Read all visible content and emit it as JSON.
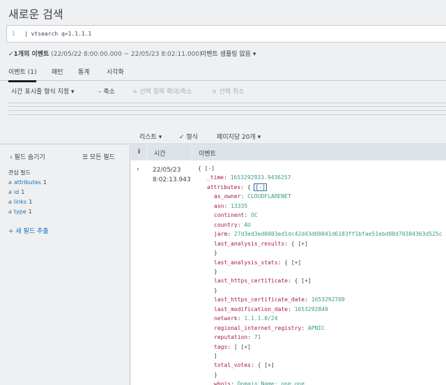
{
  "page": {
    "title": "새로운 검색"
  },
  "search": {
    "line_number": "1",
    "query": "| vtsearch q=1.1.1.1"
  },
  "summary": {
    "check": "✓",
    "count": "1개의 이벤트",
    "range": "(22/05/22 8:00:00.000 ~ 22/05/23 8:02:11.000)",
    "sampling": "이벤트 샘플링 없음 ▾"
  },
  "tabs": [
    "이벤트 (1)",
    "패턴",
    "통계",
    "시각화"
  ],
  "toolbar": {
    "time_format": "시간 표시줄 형식 지정 ▾",
    "zoom_out": "– 축소",
    "zoom_selection": "+ 선택 항목 확대/축소",
    "deselect": "× 선택 취소"
  },
  "pager": {
    "list": "리스트 ▾",
    "format": "✓ 형식",
    "per_page": "페이지당 20개 ▾"
  },
  "sidebar": {
    "hide_fields": "‹ 필드 숨기기",
    "all_fields": "☰ 모든 필드",
    "interesting_title": "관심 필드",
    "fields": [
      {
        "type": "a",
        "name": "attributes",
        "count": "1"
      },
      {
        "type": "a",
        "name": "id",
        "count": "1"
      },
      {
        "type": "a",
        "name": "links",
        "count": "1"
      },
      {
        "type": "a",
        "name": "type",
        "count": "1"
      }
    ],
    "extract": "+ 새 필드 추출"
  },
  "grid": {
    "info_icon": "i",
    "time_header": "시간",
    "event_header": "이벤트"
  },
  "event": {
    "expander": "›",
    "date": "22/05/23",
    "time": "8:02:13.943",
    "lines": [
      {
        "indent": 0,
        "key": "",
        "value": "",
        "tail": "{ [-]"
      },
      {
        "indent": 1,
        "key": "_time",
        "value": "1653292933.9436257",
        "tail": ""
      },
      {
        "indent": 1,
        "key": "attributes",
        "value": "",
        "tail": "{",
        "toggle": "[-]",
        "selected": true
      },
      {
        "indent": 2,
        "key": "as_owner",
        "value": "CLOUDFLARENET",
        "tail": ""
      },
      {
        "indent": 2,
        "key": "asn",
        "value": "13335",
        "tail": ""
      },
      {
        "indent": 2,
        "key": "continent",
        "value": "OC",
        "tail": ""
      },
      {
        "indent": 2,
        "key": "country",
        "value": "AU",
        "tail": ""
      },
      {
        "indent": 2,
        "key": "jarm",
        "value": "27d3ed3ed0003ed1dc42d43d00041d6183ff1bfae51ebd88d70384363d525c",
        "tail": ""
      },
      {
        "indent": 2,
        "key": "last_analysis_results",
        "value": "",
        "tail": "{",
        "toggle": "[+]"
      },
      {
        "indent": 2,
        "key": "",
        "value": "",
        "tail": "}"
      },
      {
        "indent": 2,
        "key": "last_analysis_stats",
        "value": "",
        "tail": "{",
        "toggle": "[+]"
      },
      {
        "indent": 2,
        "key": "",
        "value": "",
        "tail": "}"
      },
      {
        "indent": 2,
        "key": "last_https_certificate",
        "value": "",
        "tail": "{",
        "toggle": "[+]"
      },
      {
        "indent": 2,
        "key": "",
        "value": "",
        "tail": "}"
      },
      {
        "indent": 2,
        "key": "last_https_certificate_date",
        "value": "1653292700",
        "tail": ""
      },
      {
        "indent": 2,
        "key": "last_modification_date",
        "value": "1653292849",
        "tail": ""
      },
      {
        "indent": 2,
        "key": "network",
        "value": "1.1.1.0/24",
        "tail": ""
      },
      {
        "indent": 2,
        "key": "regional_internet_registry",
        "value": "APNIC",
        "tail": ""
      },
      {
        "indent": 2,
        "key": "reputation",
        "value": "71",
        "tail": ""
      },
      {
        "indent": 2,
        "key": "tags",
        "value": "",
        "tail": "[",
        "toggle": "[+]"
      },
      {
        "indent": 2,
        "key": "",
        "value": "",
        "tail": "]"
      },
      {
        "indent": 2,
        "key": "total_votes",
        "value": "",
        "tail": "{",
        "toggle": "[+]"
      },
      {
        "indent": 2,
        "key": "",
        "value": "",
        "tail": "}"
      },
      {
        "indent": 2,
        "key": "whois",
        "value": "Domain Name: one.one",
        "tail": ""
      }
    ]
  },
  "colors": {
    "key": "#a51c3c",
    "value": "#3a9a85",
    "link": "#1a6fb8",
    "accent_tab": "#1a1c20"
  }
}
